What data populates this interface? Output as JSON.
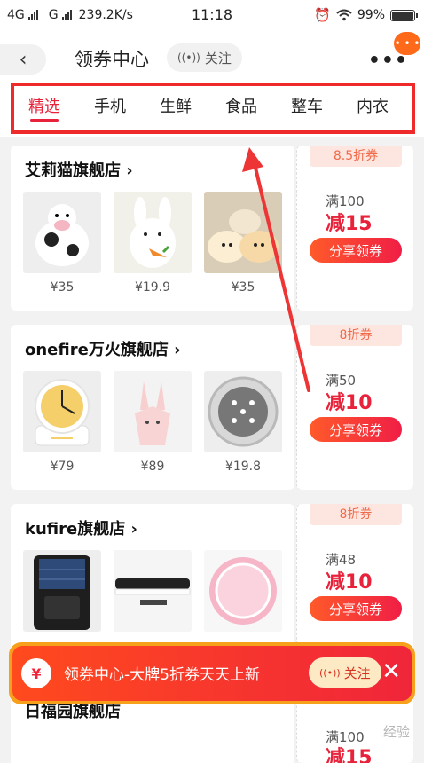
{
  "status_bar": {
    "network_left": "4G",
    "network_right": "G",
    "speed": "239.2K/s",
    "time": "11:18",
    "battery_text": "99%",
    "battery_level": 0.99
  },
  "header": {
    "back_icon": "chevron-left-icon",
    "title": "领券中心",
    "follow_label": "关注",
    "more_icon": "more-dots-icon",
    "chat_text": "• • •"
  },
  "tabs": [
    {
      "label": "精选",
      "active": true
    },
    {
      "label": "手机",
      "active": false
    },
    {
      "label": "生鲜",
      "active": false
    },
    {
      "label": "食品",
      "active": false
    },
    {
      "label": "整车",
      "active": false
    },
    {
      "label": "内衣",
      "active": false
    }
  ],
  "shops": [
    {
      "name": "艾莉猫旗舰店",
      "products": [
        {
          "image": "cow-plush-toy",
          "price": "¥35"
        },
        {
          "image": "white-rabbit-plush",
          "price": "¥19.9"
        },
        {
          "image": "animal-pillow-plush",
          "price": "¥35"
        }
      ],
      "coupon": {
        "discount": "8.5折券",
        "threshold": "满100",
        "reduction": "减15",
        "button": "分享领券"
      }
    },
    {
      "name": "onefire万火旗舰店",
      "products": [
        {
          "image": "desk-clock",
          "price": "¥79"
        },
        {
          "image": "pink-bunny-lamp",
          "price": "¥89"
        },
        {
          "image": "round-led-light",
          "price": "¥19.8"
        }
      ],
      "coupon": {
        "discount": "8折券",
        "threshold": "满50",
        "reduction": "减10",
        "button": "分享领券"
      }
    },
    {
      "name": "kufire旗舰店",
      "products": [
        {
          "image": "solar-wall-light",
          "price": ""
        },
        {
          "image": "led-light-bar",
          "price": ""
        },
        {
          "image": "pink-ring-mirror",
          "price": ""
        }
      ],
      "coupon": {
        "discount": "8折券",
        "threshold": "满48",
        "reduction": "减10",
        "button": "分享领券"
      }
    }
  ],
  "banner": {
    "icon_text": "¥",
    "text": "领券中心-大牌5折券天天上新",
    "follow_label": "关注",
    "close_icon": "close-icon"
  },
  "partial_card": {
    "name": "日福园旗舰店",
    "threshold": "满100",
    "reduction": "减15",
    "watermark": "经验"
  },
  "colors": {
    "accent": "#e8223a",
    "highlight_box": "#ee2a2a",
    "banner_border": "#f7a01c"
  }
}
